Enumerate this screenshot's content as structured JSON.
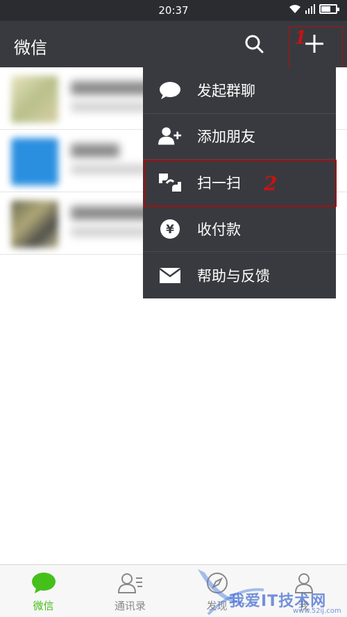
{
  "status_bar": {
    "time": "20:37"
  },
  "header": {
    "title": "微信",
    "annotation_1": "1"
  },
  "chats": [
    {
      "avatar_color": "#c8c89a"
    },
    {
      "avatar_color": "#2b8fe0"
    },
    {
      "avatar_color": "#8a8a6a"
    }
  ],
  "menu": {
    "items": [
      {
        "label": "发起群聊",
        "icon": "chat-bubble-icon"
      },
      {
        "label": "添加朋友",
        "icon": "add-friend-icon"
      },
      {
        "label": "扫一扫",
        "icon": "scan-icon"
      },
      {
        "label": "收付款",
        "icon": "payment-icon"
      },
      {
        "label": "帮助与反馈",
        "icon": "mail-icon"
      }
    ],
    "annotation_2": "2"
  },
  "tabs": [
    {
      "label": "微信",
      "icon": "chats-icon",
      "active": true
    },
    {
      "label": "通讯录",
      "icon": "contacts-icon",
      "active": false
    },
    {
      "label": "发现",
      "icon": "discover-icon",
      "active": false
    },
    {
      "label": "我",
      "icon": "me-icon",
      "active": false
    }
  ],
  "watermark": {
    "text": "我爱IT技术网",
    "url": "www.52ij.com"
  },
  "colors": {
    "accent": "#45c01a",
    "header_bg": "#393a3f",
    "menu_bg": "#393a3f",
    "annotation": "#c41414"
  }
}
